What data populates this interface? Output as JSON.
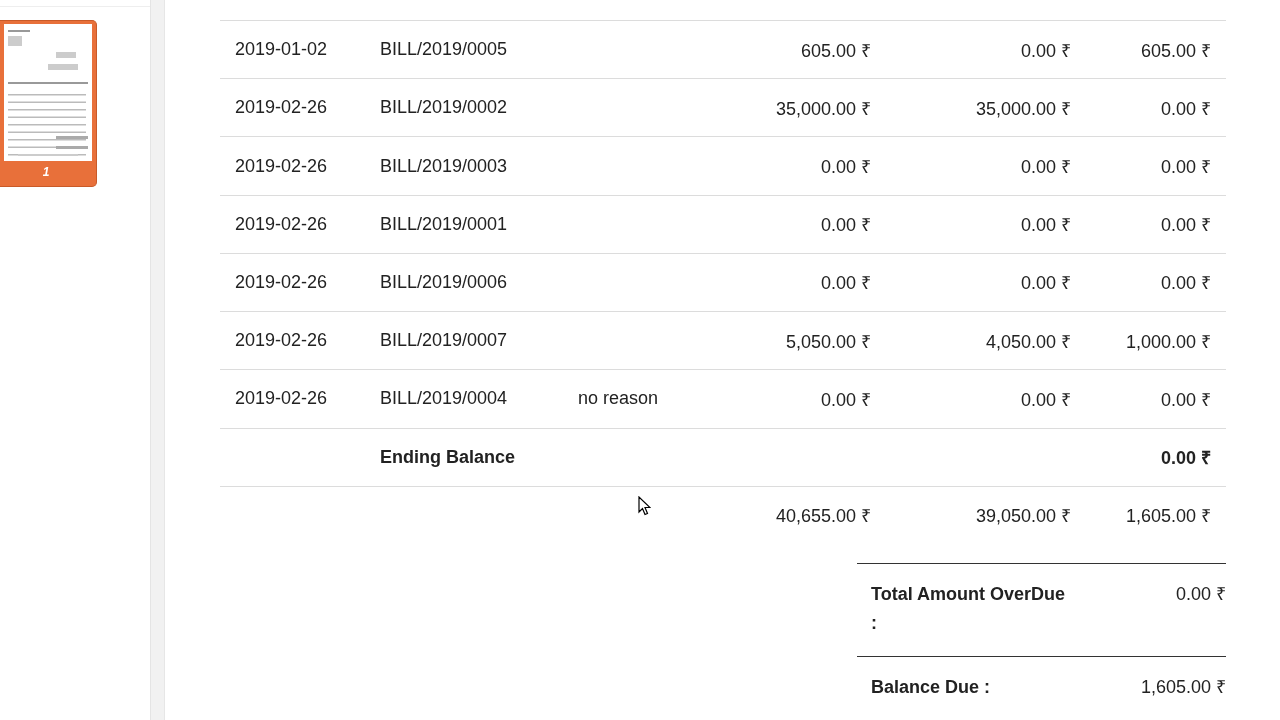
{
  "sidebar": {
    "thumbnails": [
      {
        "label": "1",
        "selected": true
      }
    ]
  },
  "table": {
    "rows": [
      {
        "kind": "line",
        "date": "2019-01-02",
        "reference": "BILL/2019/0005",
        "reason": "",
        "amount": "605.00 ₹",
        "paid": "0.00 ₹",
        "balance": "605.00 ₹"
      },
      {
        "kind": "line",
        "date": "2019-02-26",
        "reference": "BILL/2019/0002",
        "reason": "",
        "amount": "35,000.00 ₹",
        "paid": "35,000.00 ₹",
        "balance": "0.00 ₹"
      },
      {
        "kind": "line",
        "date": "2019-02-26",
        "reference": "BILL/2019/0003",
        "reason": "",
        "amount": "0.00 ₹",
        "paid": "0.00 ₹",
        "balance": "0.00 ₹"
      },
      {
        "kind": "line",
        "date": "2019-02-26",
        "reference": "BILL/2019/0001",
        "reason": "",
        "amount": "0.00 ₹",
        "paid": "0.00 ₹",
        "balance": "0.00 ₹"
      },
      {
        "kind": "line",
        "date": "2019-02-26",
        "reference": "BILL/2019/0006",
        "reason": "",
        "amount": "0.00 ₹",
        "paid": "0.00 ₹",
        "balance": "0.00 ₹"
      },
      {
        "kind": "line",
        "date": "2019-02-26",
        "reference": "BILL/2019/0007",
        "reason": "",
        "amount": "5,050.00 ₹",
        "paid": "4,050.00 ₹",
        "balance": "1,000.00 ₹"
      },
      {
        "kind": "line",
        "date": "2019-02-26",
        "reference": "BILL/2019/0004",
        "reason": "no reason",
        "amount": "0.00 ₹",
        "paid": "0.00 ₹",
        "balance": "0.00 ₹"
      },
      {
        "kind": "ending",
        "label": "Ending Balance",
        "balance": "0.00 ₹"
      },
      {
        "kind": "total",
        "amount": "40,655.00 ₹",
        "paid": "39,050.00 ₹",
        "balance": "1,605.00 ₹"
      }
    ]
  },
  "summary": [
    {
      "label": "Total Amount OverDue :",
      "value": "0.00 ₹"
    },
    {
      "label": "Balance Due :",
      "value": "1,605.00 ₹"
    }
  ]
}
